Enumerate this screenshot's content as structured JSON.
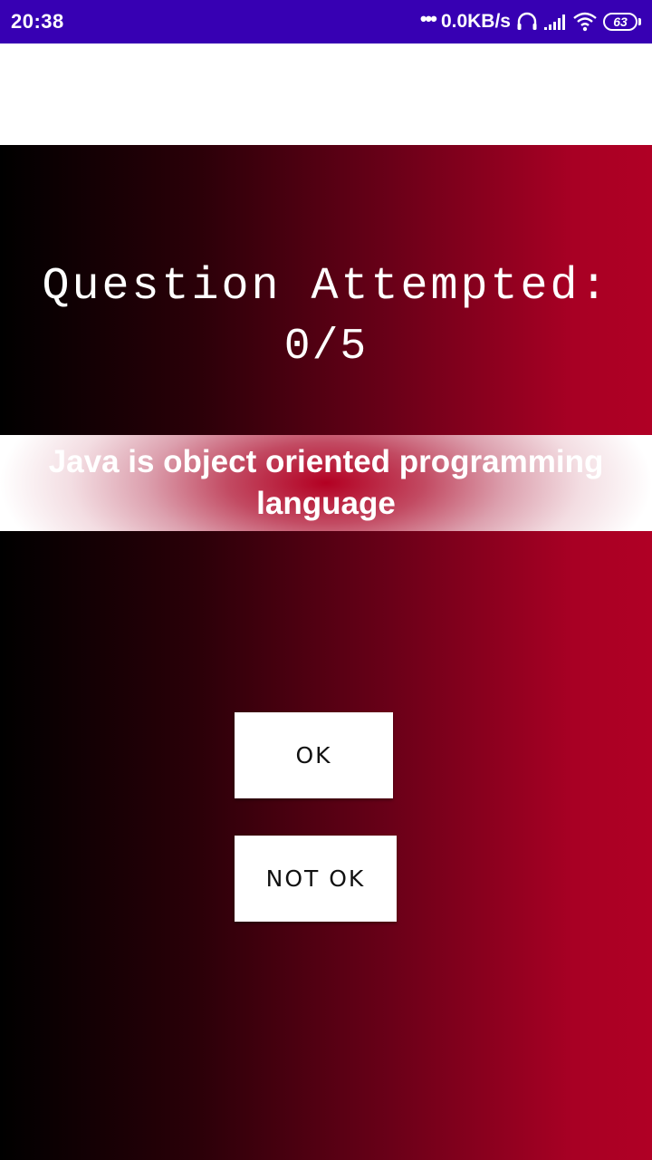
{
  "status_bar": {
    "time": "20:38",
    "dots": "•••",
    "network_speed": "0.0KB/s",
    "battery_level": "63",
    "icons": [
      "headset-icon",
      "signal-icon",
      "wifi-icon",
      "battery-icon"
    ],
    "background_color": "#3700b3"
  },
  "quiz": {
    "attempted_label": "Question Attempted:",
    "attempted_count": "0/5",
    "question": "Java is object oriented programming language",
    "gradient_colors": [
      "#000000",
      "#b00025"
    ]
  },
  "actions": {
    "ok_label": "OK",
    "not_ok_label": "NOT OK"
  }
}
